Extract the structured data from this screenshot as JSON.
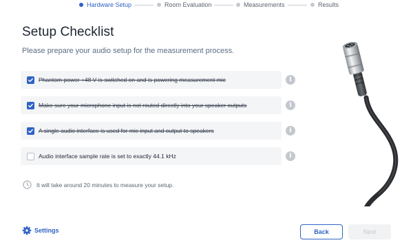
{
  "stepper": {
    "steps": [
      {
        "label": "Hardware Setup",
        "active": true
      },
      {
        "label": "Room Evaluation",
        "active": false
      },
      {
        "label": "Measurements",
        "active": false
      },
      {
        "label": "Results",
        "active": false
      }
    ]
  },
  "page": {
    "title": "Setup Checklist",
    "subtitle": "Please prepare your audio setup for the measurement process."
  },
  "checklist": {
    "items": [
      {
        "label": "Phantom power +48 V is switched on and is powering measurement mic",
        "checked": true
      },
      {
        "label": "Make sure your microphone input is not routed directly into your speaker outputs",
        "checked": true
      },
      {
        "label": "A single audio interface is used for mic input and output to speakers",
        "checked": true
      },
      {
        "label": "Audio interface sample rate is set to exactly 44.1 kHz",
        "checked": false
      }
    ],
    "info_icon": "i"
  },
  "time_note": "It will take around 20 minutes to measure your setup.",
  "footer": {
    "settings_label": "Settings",
    "back_label": "Back",
    "next_label": "Next"
  },
  "colors": {
    "accent": "#2f63c4",
    "row_background": "#f4f5f7",
    "info_icon": "#c4c8ce"
  },
  "icons": [
    "clock-icon",
    "gear-icon",
    "info-icon",
    "check-icon",
    "xlr-cable-illustration"
  ]
}
